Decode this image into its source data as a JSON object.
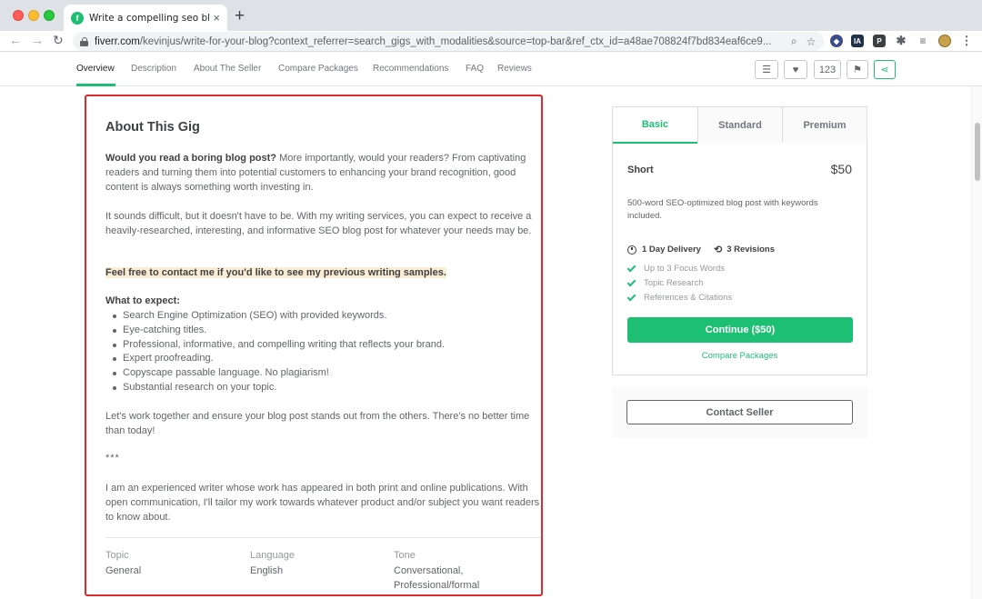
{
  "browser": {
    "tab_title": "Write a compelling seo blog po",
    "url_host": "fiverr.com",
    "url_path": "/kevinjus/write-for-your-blog?context_referrer=search_gigs_with_modalities&source=top-bar&ref_ctx_id=a48ae708824f7bd834eaf6ce9...",
    "new_tab": "+",
    "close_tab": "×"
  },
  "subnav": {
    "items": [
      "Overview",
      "Description",
      "About The Seller",
      "Compare Packages",
      "Recommendations",
      "FAQ",
      "Reviews"
    ],
    "active": "Overview",
    "likes_count": "123"
  },
  "about": {
    "title": "About This Gig",
    "intro_bold": "Would you read a boring blog post?",
    "intro_rest": " More importantly, would your readers? From captivating readers and turning them into potential customers to enhancing your brand recognition, good content is always something worth investing in.",
    "para2": "It sounds difficult, but it doesn't have to be. With my writing services, you can expect to receive a heavily-researched, interesting, and informative SEO blog post for whatever your needs may be.",
    "highlight": "Feel free to contact me if you'd like to see my previous writing samples.",
    "expect_heading": "What to expect:",
    "bullets": [
      "Search Engine Optimization (SEO) with provided keywords.",
      "Eye-catching titles.",
      "Professional, informative, and compelling writing that reflects your brand.",
      "Expert proofreading.",
      "Copyscape passable language. No plagiarism!",
      "Substantial research on your topic."
    ],
    "para3": "Let's work together and ensure your blog post stands out from the others. There's no better time than today!",
    "separator": "***",
    "para4": "I am an experienced writer whose work has appeared in both print and online publications. With open communication, I'll tailor my work towards whatever product and/or subject you want readers to know about.",
    "meta": [
      {
        "label": "Topic",
        "value": "General"
      },
      {
        "label": "Language",
        "value": "English"
      },
      {
        "label": "Tone",
        "value": "Conversational, Professional/formal"
      }
    ]
  },
  "packages": {
    "tabs": [
      "Basic",
      "Standard",
      "Premium"
    ],
    "name": "Short",
    "price": "$50",
    "description": "500-word SEO-optimized blog post with keywords included.",
    "delivery": "1 Day Delivery",
    "revisions": "3 Revisions",
    "features": [
      "Up to 3 Focus Words",
      "Topic Research",
      "References & Citations"
    ],
    "continue_label": "Continue ($50)",
    "compare_label": "Compare Packages",
    "contact_label": "Contact Seller"
  },
  "colors": {
    "brand_green": "#1dbf73",
    "annotation_red": "#e0292a",
    "highlight": "#fbecd4"
  }
}
